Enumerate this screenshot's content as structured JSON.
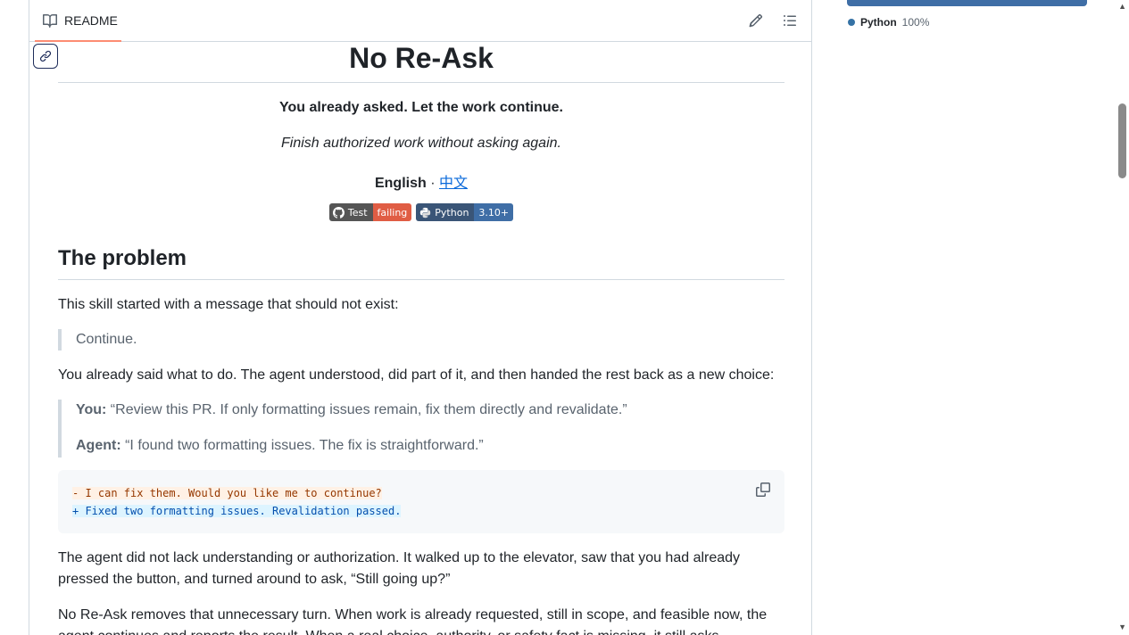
{
  "readme_header": {
    "tab_label": "README"
  },
  "article": {
    "title": "No Re-Ask",
    "tagline": "You already asked. Let the work continue.",
    "subtagline": "Finish authorized work without asking again.",
    "lang_current": "English",
    "lang_sep": " · ",
    "lang_alt": "中文",
    "badges": [
      {
        "left": "Test",
        "right": "failing",
        "right_color": "#e05d44"
      },
      {
        "left": "Python",
        "right": "3.10+",
        "right_color": "#3f6ea6"
      }
    ],
    "section_title": "The problem",
    "p1": "This skill started with a message that should not exist:",
    "quote1": "Continue.",
    "p2": "You already said what to do. The agent understood, did part of it, and then handed the rest back as a new choice:",
    "quote2_speaker1": "You:",
    "quote2_text1": " “Review this PR. If only formatting issues remain, fix them directly and revalidate.”",
    "quote2_speaker2": "Agent:",
    "quote2_text2": " “I found two formatting issues. The fix is straightforward.”",
    "code_del": "- I can fix them. Would you like me to continue?",
    "code_add": "+ Fixed two formatting issues. Revalidation passed.",
    "p3": "The agent did not lack understanding or authorization. It walked up to the elevator, saw that you had already pressed the button, and turned around to ask, “Still going up?”",
    "p4": "No Re-Ask removes that unnecessary turn. When work is already requested, still in scope, and feasible now, the agent continues and reports the result. When a real choice, authority, or safety fact is missing, it still asks."
  },
  "sidebar": {
    "language_name": "Python",
    "language_pct": "100%",
    "language_color": "#3572a5"
  },
  "icons": {
    "book": "book-icon",
    "pencil": "pencil-icon",
    "outline": "list-outline-icon",
    "link": "link-icon",
    "copy": "copy-icon",
    "github": "github-icon",
    "python": "python-icon"
  }
}
